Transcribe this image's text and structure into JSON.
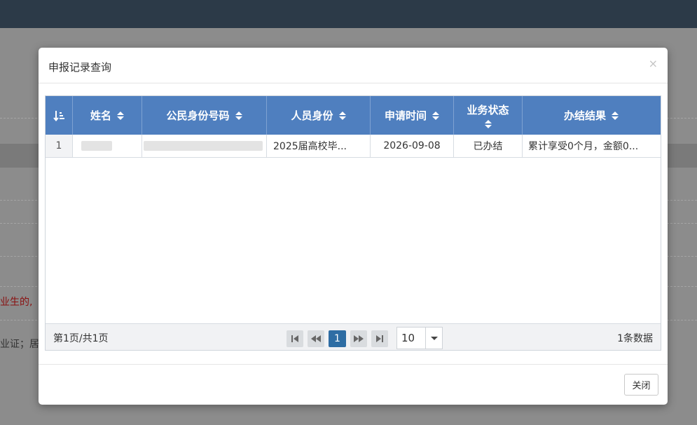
{
  "background": {
    "red_text": "业生的,",
    "gray_text": "业证；居"
  },
  "modal": {
    "title": "申报记录查询",
    "close_x": "×",
    "close_button": "关闭"
  },
  "table": {
    "columns": [
      "姓名",
      "公民身份号码",
      "人员身份",
      "申请时间",
      "业务状态",
      "办结结果"
    ],
    "rows": [
      {
        "index": "1",
        "name": "",
        "id_number": "",
        "identity": "2025届高校毕...",
        "apply_time": "2026-09-08",
        "status": "已办结",
        "result": "累计享受0个月，金额0..."
      }
    ]
  },
  "pager": {
    "page_info": "第1页/共1页",
    "current_page": "1",
    "page_size": "10",
    "total": "1条数据"
  }
}
